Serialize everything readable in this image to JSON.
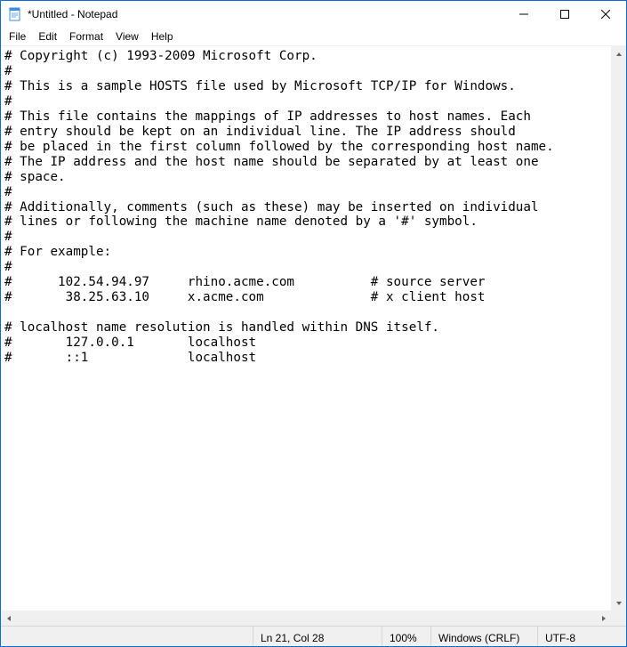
{
  "titlebar": {
    "title": "*Untitled - Notepad"
  },
  "menu": {
    "file": "File",
    "edit": "Edit",
    "format": "Format",
    "view": "View",
    "help": "Help"
  },
  "editor": {
    "content": "# Copyright (c) 1993-2009 Microsoft Corp.\n#\n# This is a sample HOSTS file used by Microsoft TCP/IP for Windows.\n#\n# This file contains the mappings of IP addresses to host names. Each\n# entry should be kept on an individual line. The IP address should\n# be placed in the first column followed by the corresponding host name.\n# The IP address and the host name should be separated by at least one\n# space.\n#\n# Additionally, comments (such as these) may be inserted on individual\n# lines or following the machine name denoted by a '#' symbol.\n#\n# For example:\n#\n#      102.54.94.97     rhino.acme.com          # source server\n#       38.25.63.10     x.acme.com              # x client host\n\n# localhost name resolution is handled within DNS itself.\n#       127.0.0.1       localhost\n#       ::1             localhost"
  },
  "status": {
    "lncol": "Ln 21, Col 28",
    "zoom": "100%",
    "eol": "Windows (CRLF)",
    "encoding": "UTF-8"
  }
}
